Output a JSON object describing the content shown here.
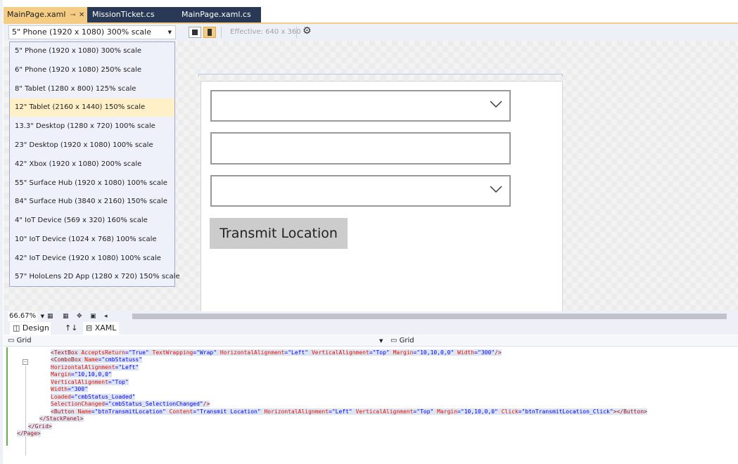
{
  "tabs": [
    {
      "label": "MainPage.xaml",
      "active": true
    },
    {
      "label": "MissionTicket.cs",
      "active": false
    },
    {
      "label": "MainPage.xaml.cs",
      "active": false
    }
  ],
  "toolbar": {
    "device_selected": "5\" Phone (1920 x 1080) 300% scale",
    "effective": "Effective: 640 x 360"
  },
  "device_options": [
    "5\" Phone (1920 x 1080) 300% scale",
    "6\" Phone (1920 x 1080) 250% scale",
    "8\" Tablet (1280 x 800) 125% scale",
    "12\" Tablet (2160 x 1440) 150% scale",
    "13.3\" Desktop (1280 x 720) 100% scale",
    "23\" Desktop (1920 x 1080) 100% scale",
    "42\" Xbox (1920 x 1080) 200% scale",
    "55\" Surface Hub (1920 x 1080) 100% scale",
    "84\" Surface Hub (3840 x 2160) 150% scale",
    "4\" IoT Device (569 x 320) 160% scale",
    "10\" IoT Device (1024 x 768) 100% scale",
    "42\" IoT Device (1920 x 1080) 100% scale",
    "57\" HoloLens 2D App (1280 x 720) 150% scale"
  ],
  "device_highlighted": "12\" Tablet (2160 x 1440) 150% scale",
  "design": {
    "button_label": "Transmit Location"
  },
  "bottom": {
    "zoom": "66.67%",
    "tab_design": "Design",
    "tab_xaml": "XAML",
    "swap_symbol": "↑↓",
    "crumb_left": "Grid",
    "crumb_right": "Grid"
  },
  "code_lines": [
    [
      [
        "        ",
        ""
      ],
      [
        "<TextBox ",
        "tg"
      ],
      [
        "AcceptsReturn",
        "at"
      ],
      [
        "=",
        "pn"
      ],
      [
        "\"True\" ",
        "vl"
      ],
      [
        "TextWrapping",
        "at"
      ],
      [
        "=",
        "pn"
      ],
      [
        "\"Wrap\" ",
        "vl"
      ],
      [
        "HorizontalAlignment",
        "at"
      ],
      [
        "=",
        "pn"
      ],
      [
        "\"Left\" ",
        "vl"
      ],
      [
        "VerticalAlignment",
        "at"
      ],
      [
        "=",
        "pn"
      ],
      [
        "\"Top\" ",
        "vl"
      ],
      [
        "Margin",
        "at"
      ],
      [
        "=",
        "pn"
      ],
      [
        "\"10,10,0,0\" ",
        "vl"
      ],
      [
        "Width",
        "at"
      ],
      [
        "=",
        "pn"
      ],
      [
        "\"300\"",
        "vl"
      ],
      [
        "/>",
        "tg"
      ]
    ],
    [
      [
        "        ",
        ""
      ],
      [
        "<ComboBox ",
        "tg"
      ],
      [
        "Name",
        "at"
      ],
      [
        "=",
        "pn"
      ],
      [
        "\"cmbStatuss\"",
        "vl"
      ]
    ],
    [
      [
        "        ",
        ""
      ],
      [
        "HorizontalAlignment",
        "at"
      ],
      [
        "=",
        "pn"
      ],
      [
        "\"Left\"",
        "vl"
      ]
    ],
    [
      [
        "        ",
        ""
      ],
      [
        "Margin",
        "at"
      ],
      [
        "=",
        "pn"
      ],
      [
        "\"10,10,0,0\"",
        "vl"
      ]
    ],
    [
      [
        "        ",
        ""
      ],
      [
        "VerticalAlignment",
        "at"
      ],
      [
        "=",
        "pn"
      ],
      [
        "\"Top\"",
        "vl"
      ]
    ],
    [
      [
        "        ",
        ""
      ],
      [
        "Width",
        "at"
      ],
      [
        "=",
        "pn"
      ],
      [
        "\"300\"",
        "vl"
      ]
    ],
    [
      [
        "        ",
        ""
      ],
      [
        "Loaded",
        "at"
      ],
      [
        "=",
        "pn"
      ],
      [
        "\"cmbStatus_Loaded\"",
        "vl"
      ]
    ],
    [
      [
        "        ",
        ""
      ],
      [
        "SelectionChanged",
        "at"
      ],
      [
        "=",
        "pn"
      ],
      [
        "\"cmbStatus_SelectionChanged\"",
        "vl"
      ],
      [
        "/>",
        "tg"
      ]
    ],
    [
      [
        "        ",
        ""
      ],
      [
        "<Button ",
        "tg"
      ],
      [
        "Name",
        "at"
      ],
      [
        "=",
        "pn"
      ],
      [
        "\"btnTransmitLocation\" ",
        "vl"
      ],
      [
        "Content",
        "at"
      ],
      [
        "=",
        "pn"
      ],
      [
        "\"Transmit Location\" ",
        "vl"
      ],
      [
        "HorizontalAlignment",
        "at"
      ],
      [
        "=",
        "pn"
      ],
      [
        "\"Left\" ",
        "vl"
      ],
      [
        "VerticalAlignment",
        "at"
      ],
      [
        "=",
        "pn"
      ],
      [
        "\"Top\" ",
        "vl"
      ],
      [
        "Margin",
        "at"
      ],
      [
        "=",
        "pn"
      ],
      [
        "\"10,10,0,0\" ",
        "vl"
      ],
      [
        "Click",
        "at"
      ],
      [
        "=",
        "pn"
      ],
      [
        "\"btnTransmitLocation_Click\"",
        "vl"
      ],
      [
        "></Button>",
        "tg"
      ]
    ],
    [
      [
        "    ",
        ""
      ],
      [
        "</StackPanel>",
        "tg"
      ]
    ],
    [
      [
        "  ",
        ""
      ],
      [
        "</Grid>",
        "tg"
      ]
    ],
    [
      [
        "",
        ""
      ],
      [
        "</Page>",
        "tg"
      ]
    ]
  ]
}
